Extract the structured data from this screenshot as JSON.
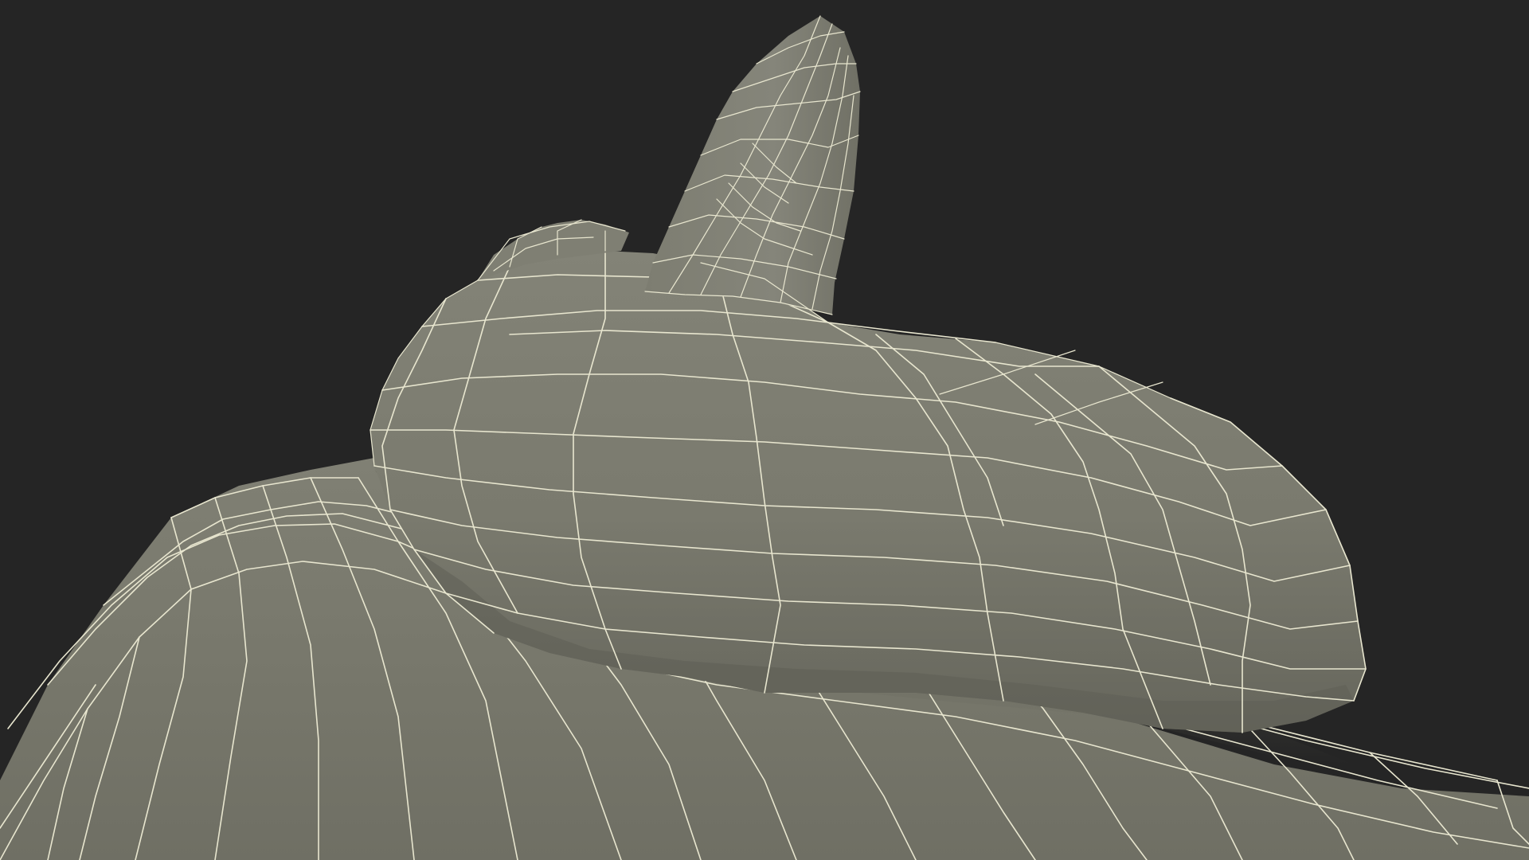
{
  "scene": {
    "background_color": "#252525",
    "surface_color": "#7b7b6f",
    "surface_shadow_color": "#5d5d53",
    "wire_color": "#e8e6cf",
    "render_mode": "wireframe-on-shaded"
  }
}
